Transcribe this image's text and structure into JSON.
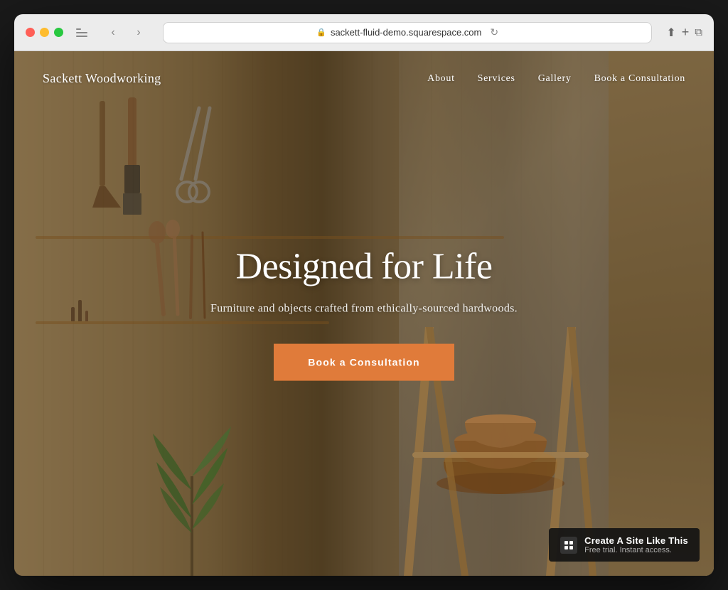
{
  "browser": {
    "url": "sackett-fluid-demo.squarespace.com",
    "reload_icon": "↻",
    "back_icon": "‹",
    "forward_icon": "›",
    "share_icon": "⬆",
    "new_tab_icon": "+",
    "windows_icon": "⧉",
    "sidebar_icon": "☰"
  },
  "nav": {
    "logo": "Sackett Woodworking",
    "links": [
      {
        "label": "About",
        "id": "about"
      },
      {
        "label": "Services",
        "id": "services"
      },
      {
        "label": "Gallery",
        "id": "gallery"
      },
      {
        "label": "Book a Consultation",
        "id": "book"
      }
    ]
  },
  "hero": {
    "title": "Designed for Life",
    "subtitle": "Furniture and objects crafted from ethically-sourced hardwoods.",
    "cta_label": "Book a Consultation"
  },
  "badge": {
    "title": "Create A Site Like This",
    "subtitle": "Free trial. Instant access.",
    "icon": "◈"
  }
}
